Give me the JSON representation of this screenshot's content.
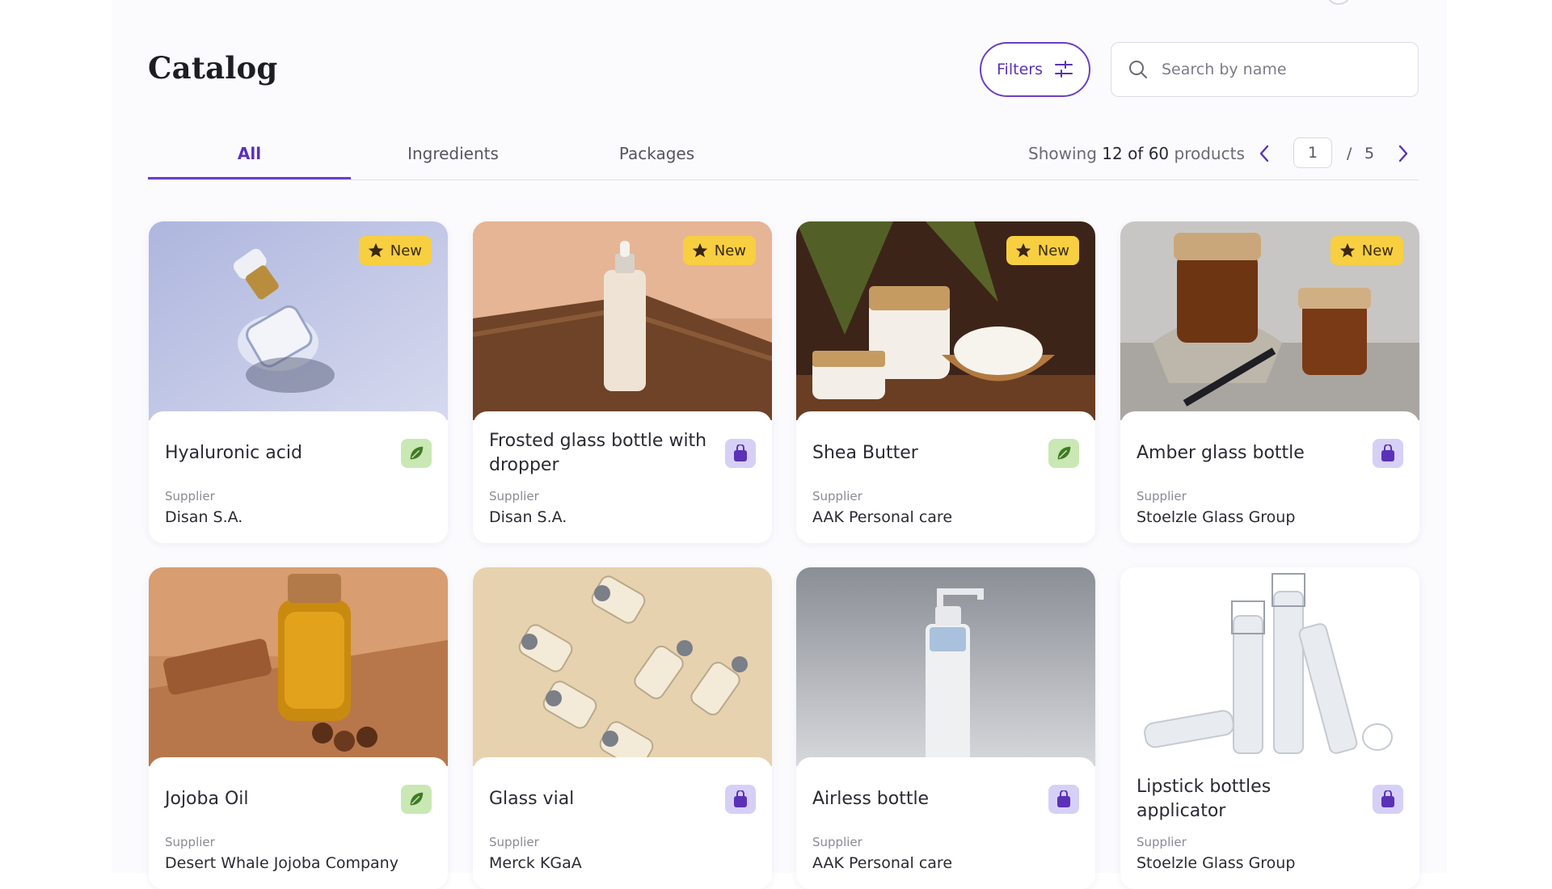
{
  "header": {
    "title": "Catalog",
    "filters_label": "Filters",
    "search_placeholder": "Search by name"
  },
  "tabs": [
    {
      "label": "All",
      "active": true
    },
    {
      "label": "Ingredients",
      "active": false
    },
    {
      "label": "Packages",
      "active": false
    }
  ],
  "pagination": {
    "showing_prefix": "Showing",
    "showing_count": "12 of 60",
    "showing_suffix": "products",
    "current_page": "1",
    "separator": "/",
    "total_pages": "5"
  },
  "badge_new_label": "New",
  "supplier_label": "Supplier",
  "colors": {
    "accent": "#6a3fc7",
    "new_badge": "#f7cf40",
    "ingredient_badge": "#c9e8b4",
    "package_badge": "#d6d0f6"
  },
  "products": [
    {
      "name": "Hyaluronic acid",
      "supplier": "Disan S.A.",
      "type": "ingredient",
      "type_icon": "leaf-icon",
      "is_new": true
    },
    {
      "name": "Frosted glass bottle with dropper",
      "supplier": "Disan S.A.",
      "type": "package",
      "type_icon": "bag-icon",
      "is_new": true
    },
    {
      "name": "Shea Butter",
      "supplier": "AAK Personal care",
      "type": "ingredient",
      "type_icon": "leaf-icon",
      "is_new": true
    },
    {
      "name": "Amber glass bottle",
      "supplier": "Stoelzle Glass Group",
      "type": "package",
      "type_icon": "bag-icon",
      "is_new": true
    },
    {
      "name": "Jojoba Oil",
      "supplier": "Desert Whale Jojoba Company",
      "type": "ingredient",
      "type_icon": "leaf-icon",
      "is_new": false
    },
    {
      "name": "Glass vial",
      "supplier": "Merck KGaA",
      "type": "package",
      "type_icon": "bag-icon",
      "is_new": false
    },
    {
      "name": "Airless bottle",
      "supplier": "AAK Personal care",
      "type": "package",
      "type_icon": "bag-icon",
      "is_new": false
    },
    {
      "name": "Lipstick bottles applicator",
      "supplier": "Stoelzle Glass Group",
      "type": "package",
      "type_icon": "bag-icon",
      "is_new": false
    }
  ]
}
